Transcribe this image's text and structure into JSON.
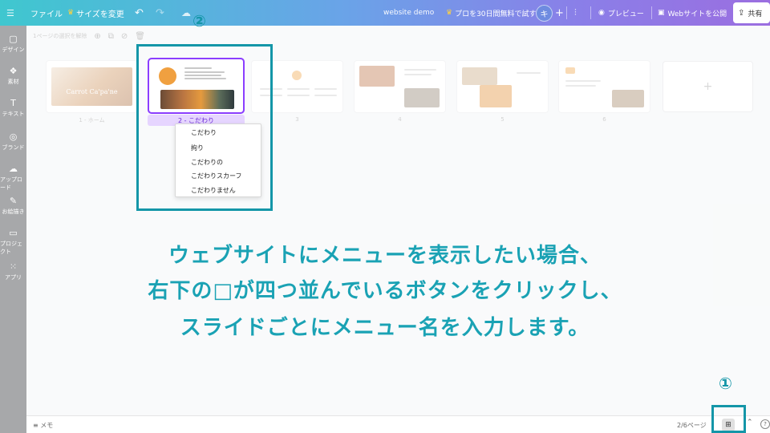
{
  "topbar": {
    "menu_icon": "☰",
    "file": "ファイル",
    "resize": "サイズを変更",
    "doc_name": "website demo",
    "trial": "プロを30日間無料で試す",
    "avatar_initial": "キ",
    "preview": "プレビュー",
    "publish": "Webサイトを公開",
    "share": "共有"
  },
  "sidebar": {
    "items": [
      {
        "icon": "▢",
        "label": "デザイン"
      },
      {
        "icon": "❖",
        "label": "素材"
      },
      {
        "icon": "T",
        "label": "テキスト"
      },
      {
        "icon": "◎",
        "label": "ブランド"
      },
      {
        "icon": "☁",
        "label": "アップロード"
      },
      {
        "icon": "✎",
        "label": "お絵描き"
      },
      {
        "icon": "▭",
        "label": "プロジェクト"
      },
      {
        "icon": "⁙",
        "label": "アプリ"
      }
    ]
  },
  "toolbar": {
    "deselect": "1ページの選択を解除"
  },
  "pages": [
    {
      "label": "1 - ホーム"
    },
    {
      "label": "2 - こだわり"
    },
    {
      "label": "3"
    },
    {
      "label": "4"
    },
    {
      "label": "5"
    },
    {
      "label": "6"
    }
  ],
  "page1_overlay_text": "Carrot Ca'pa'ne",
  "dropdown": {
    "items": [
      "こだわり",
      "拘り",
      "こだわりの",
      "こだわりスカーフ",
      "こだわりません"
    ]
  },
  "annotations": {
    "num1": "①",
    "num2": "②",
    "instruction_lines": [
      "ウェブサイトにメニューを表示したい場合、",
      "右下の□が四つ並んでいるボタンをクリックし、",
      "スライドごとにメニュー名を入力します。"
    ]
  },
  "bottombar": {
    "memo": "メモ",
    "page_count": "2/6ページ",
    "grid_icon": "grid-view-icon",
    "help": "?"
  },
  "colors": {
    "accent_teal": "#1496a8",
    "selection_purple": "#8b3dff"
  }
}
